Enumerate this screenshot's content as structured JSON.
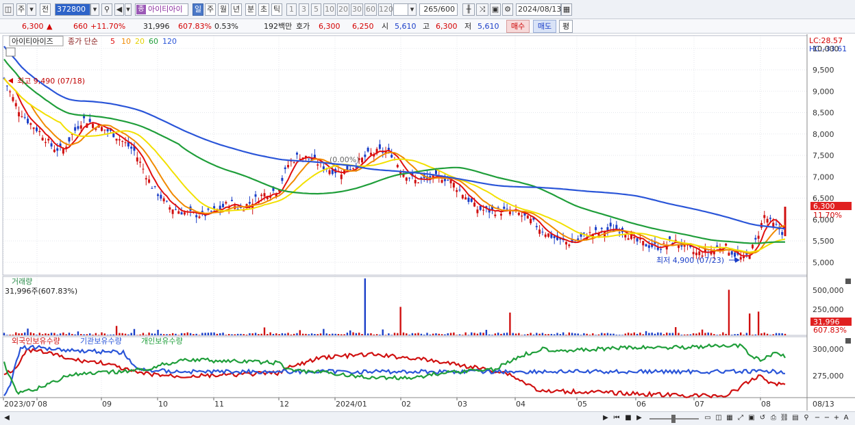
{
  "toolbar": {
    "market": "주",
    "type": "전",
    "code": "372800",
    "stock_name": "아이티아이",
    "stock_badge": "종",
    "periods": [
      "일",
      "주",
      "월",
      "년",
      "분",
      "초",
      "틱"
    ],
    "selected_period": "일",
    "intervals": [
      "1",
      "3",
      "5",
      "10",
      "20",
      "30",
      "60",
      "120"
    ],
    "count": "265",
    "max_count": "/600",
    "date": "2024/08/13"
  },
  "info": {
    "price": "6,300",
    "change": "660",
    "change_pct": "+11.70%",
    "volume": "31,996",
    "volume_pct": "607.83%",
    "turnover": "0.53%",
    "trade_value": "192백만",
    "quote_label": "호가",
    "ask": "6,300",
    "bid": "6,250",
    "open_label": "시",
    "open": "5,610",
    "high_label": "고",
    "high": "6,300",
    "low_label": "저",
    "low": "5,610",
    "buy_btn": "매수",
    "sell_btn": "매도",
    "eval_btn": "평"
  },
  "price_pane": {
    "stock_name": "아이티아이즈",
    "ma_label": "종가 단순",
    "ma_periods": [
      "5",
      "10",
      "20",
      "60",
      "120"
    ],
    "ma_colors": [
      "#e01010",
      "#f08a00",
      "#f2e000",
      "#1f9e3a",
      "#2a55d8"
    ],
    "lc": "LC:28.57",
    "hc": "HC:-33.61",
    "high_note": "최고 9,490 (07/18)",
    "low_note": "최저 4,900 (07/23)",
    "mid_note": "(0.00%)",
    "current_price_tag": "6,300",
    "current_pct_tag": "11.70%",
    "y_ticks": [
      "10,000",
      "9,500",
      "9,000",
      "8,500",
      "8,000",
      "7,500",
      "7,000",
      "6,500",
      "6,000",
      "5,500",
      "5,000"
    ]
  },
  "volume_pane": {
    "title": "거래량",
    "last_value": "31,996주(607.83%)",
    "y_ticks": [
      "500,000",
      "250,000"
    ],
    "tag_value": "31,996",
    "tag_pct": "607.83%"
  },
  "holdings_pane": {
    "legend": [
      "외국인보유수량",
      "기관보유수량",
      "개인보유수량"
    ],
    "legend_colors": [
      "#d01010",
      "#2a55d8",
      "#1f9e3a"
    ],
    "y_ticks": [
      "300,000",
      "275,000"
    ]
  },
  "x_axis": {
    "labels": [
      "2023/07",
      "08",
      "09",
      "10",
      "11",
      "12",
      "2024/01",
      "02",
      "03",
      "04",
      "05",
      "06",
      "07",
      "08"
    ],
    "right_label": "08/13"
  },
  "chart_data": {
    "type": "line",
    "title": "아이티아이즈",
    "series": [
      {
        "name": "5",
        "color": "#e01010"
      },
      {
        "name": "10",
        "color": "#f08a00"
      },
      {
        "name": "20",
        "color": "#f2e000"
      },
      {
        "name": "60",
        "color": "#1f9e3a"
      },
      {
        "name": "120",
        "color": "#2a55d8"
      }
    ],
    "ylim": [
      4700,
      10300
    ],
    "last_close": 6300,
    "period_high": 9490,
    "period_low": 4900
  }
}
